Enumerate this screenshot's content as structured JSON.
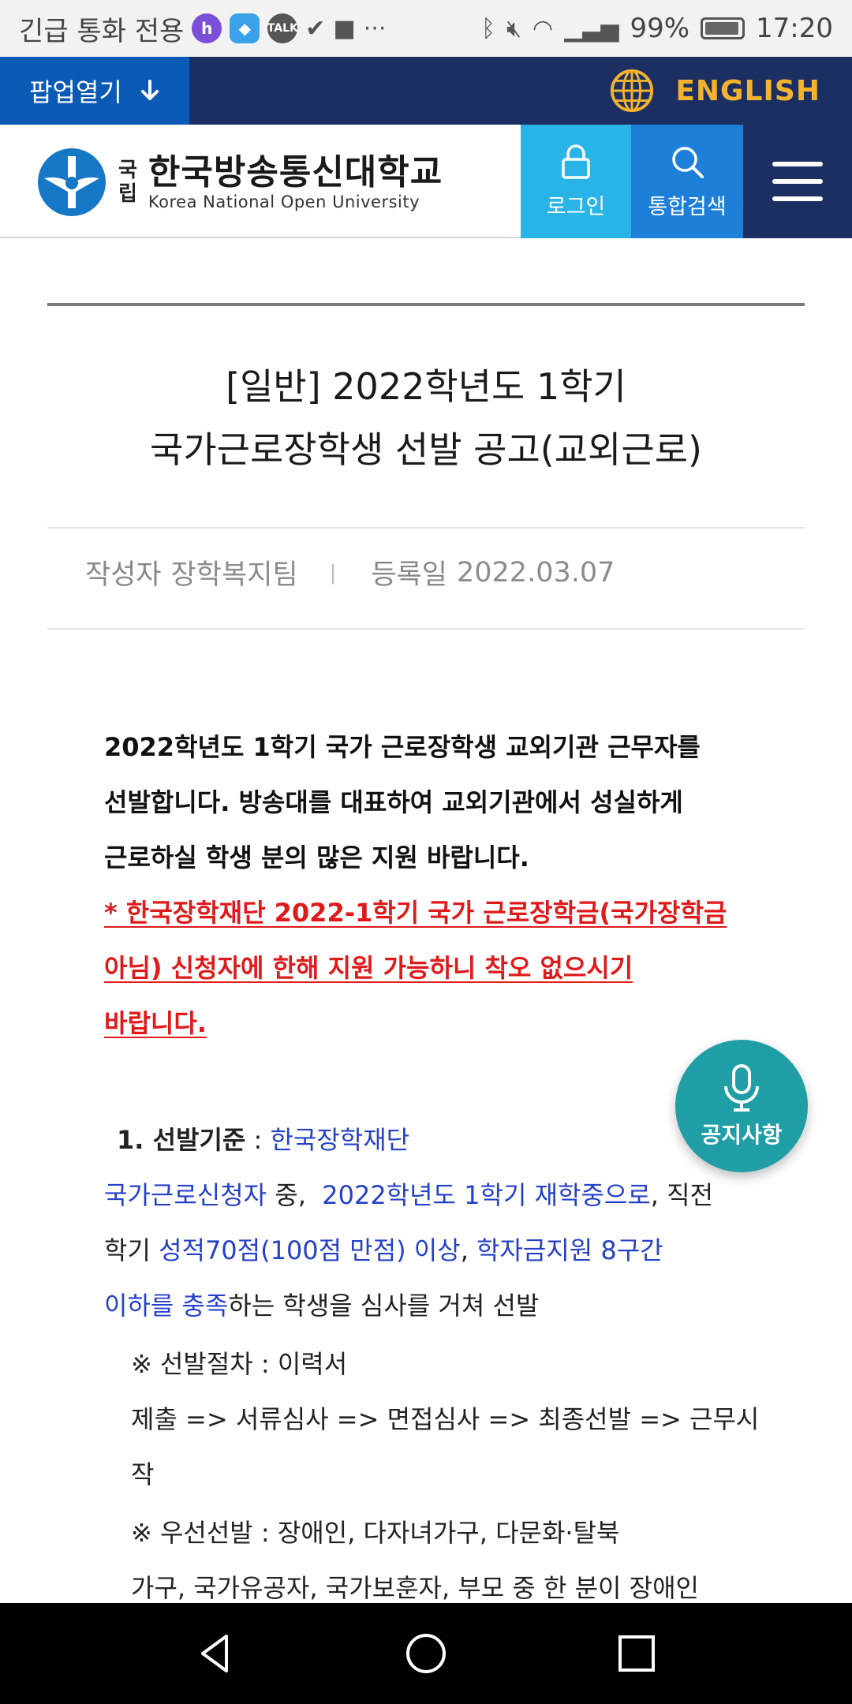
{
  "status_bar": {
    "left_text": "긴급 통화 전용",
    "battery": "99%",
    "time": "17:20",
    "icons": [
      "h-app-icon",
      "shield-app-icon",
      "talk-app-icon",
      "check-icon",
      "note-icon",
      "more-icon"
    ]
  },
  "topbar": {
    "popup_label": "팝업열기",
    "english_label": "ENGLISH"
  },
  "header": {
    "logo_small_1": "국",
    "logo_small_2": "립",
    "logo_ko": "한국방송통신대학교",
    "logo_en": "Korea National Open University",
    "login_label": "로그인",
    "search_label": "통합검색"
  },
  "article": {
    "title_line1": "[일반] 2022학년도 1학기",
    "title_line2": "국가근로장학생 선발 공고(교외근로)",
    "author_label": "작성자",
    "author": "장학복지팀",
    "date_label": "등록일",
    "date": "2022.03.07",
    "intro_line1": "2022학년도 1학기 국가 근로장학생 교외기관 근무자를",
    "intro_line2": "선발합니다. 방송대를 대표하여 교외기관에서 성실하게",
    "intro_line3": "근로하실 학생 분의 많은 지원 바랍니다.",
    "warn_line1": "* 한국장학재단 2022-1학기 국가 근로장학금(국가장학금",
    "warn_line2": "아님) 신청자에 한해 지원 가능하니 착오 없으시기",
    "warn_line3": "바랍니다.",
    "sec1_head": "1. 선발기준",
    "sec1_colon": " : ",
    "sec1_a": "한국장학재단",
    "sec1_b": "국가근로신청자",
    "sec1_c": " 중,  ",
    "sec1_d": "2022학년도 1학기 재학중으로",
    "sec1_e": ", 직전",
    "sec1_f": "학기 ",
    "sec1_g": "성적70점(100점 만점) 이상",
    "sec1_h": ", ",
    "sec1_i": "학자금지원 8구간",
    "sec1_j": "이하를 충족",
    "sec1_k": "하는 학생을 심사를 거쳐 선발",
    "note1_line1": "※ 선발절차 : 이력서",
    "note1_line2": "제출 => 서류심사 => 면접심사 => 최종선발 => 근무시",
    "note1_line3": "작",
    "note2_line1": "※ 우선선발 : 장애인, 다자녀가구, 다문화·탈북",
    "note2_line2": "가구, 국가유공자, 국가보훈자, 부모 중 한 분이 장애인"
  },
  "fab": {
    "label": "공지사항"
  },
  "colors": {
    "navy": "#1b2f63",
    "popup_blue": "#0b5ab6",
    "login_cyan": "#29b4e8",
    "search_blue": "#1e7fd8",
    "english_gold": "#f4b32c",
    "warn_red": "#e01a1a",
    "link_blue": "#2541c8",
    "fab_teal": "#1f9ea5"
  }
}
